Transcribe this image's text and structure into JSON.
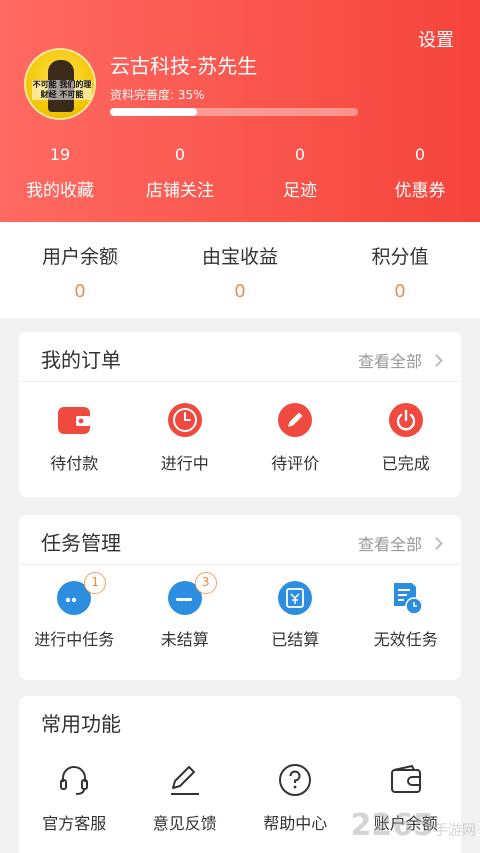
{
  "header": {
    "settings_label": "设置",
    "username": "云古科技-苏先生",
    "completeness_label": "资料完善度: 35%",
    "completeness_value": 0.35,
    "avatar_text": "不可能 我们的理财经 不可能"
  },
  "stats": [
    {
      "count": "19",
      "label": "我的收藏"
    },
    {
      "count": "0",
      "label": "店铺关注"
    },
    {
      "count": "0",
      "label": "足迹"
    },
    {
      "count": "0",
      "label": "优惠券"
    }
  ],
  "balances": [
    {
      "label": "用户余额",
      "value": "0"
    },
    {
      "label": "由宝收益",
      "value": "0"
    },
    {
      "label": "积分值",
      "value": "0"
    }
  ],
  "orders": {
    "title": "我的订单",
    "view_all": "查看全部",
    "items": [
      {
        "label": "待付款",
        "icon": "wallet-icon"
      },
      {
        "label": "进行中",
        "icon": "clock-icon"
      },
      {
        "label": "待评价",
        "icon": "pencil-icon"
      },
      {
        "label": "已完成",
        "icon": "power-icon"
      }
    ]
  },
  "tasks": {
    "title": "任务管理",
    "view_all": "查看全部",
    "items": [
      {
        "label": "进行中任务",
        "icon": "ellipsis-icon",
        "badge": "1"
      },
      {
        "label": "未结算",
        "icon": "minus-icon",
        "badge": "3"
      },
      {
        "label": "已结算",
        "icon": "yen-calendar-icon"
      },
      {
        "label": "无效任务",
        "icon": "document-clock-icon"
      }
    ]
  },
  "common": {
    "title": "常用功能",
    "items": [
      {
        "label": "官方客服",
        "icon": "headset-icon"
      },
      {
        "label": "意见反馈",
        "icon": "edit-icon"
      },
      {
        "label": "帮助中心",
        "icon": "question-icon"
      },
      {
        "label": "账户余额",
        "icon": "wallet-outline-icon"
      }
    ]
  },
  "watermark": {
    "main": "2265",
    "sub": "手游网"
  },
  "colors": {
    "header_start": "#ff6a62",
    "header_end": "#f5443b",
    "order_icon": "#f04a40",
    "task_icon": "#2d8ee0",
    "value_orange": "#f08a5d"
  }
}
